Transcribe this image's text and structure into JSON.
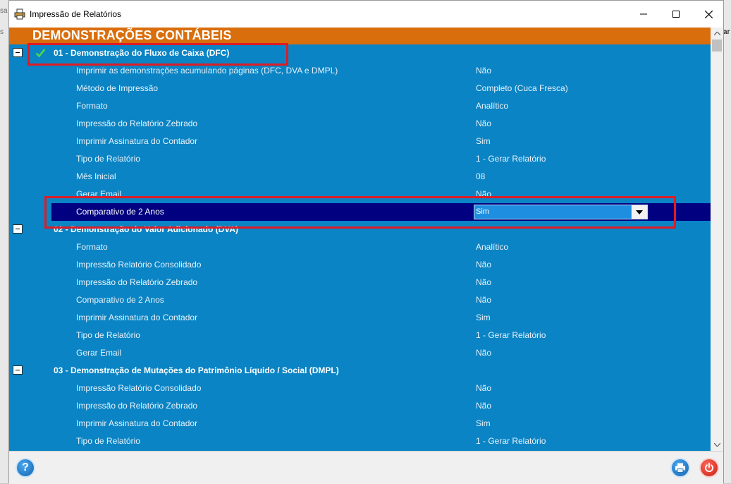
{
  "window": {
    "title": "Impressão de Relatórios",
    "minimize_icon": "minimize-icon",
    "maximize_icon": "maximize-icon",
    "close_icon": "close-icon"
  },
  "background": {
    "left_fragment_1": "sa",
    "left_fragment_2": "s",
    "right_fragment": "ar"
  },
  "header": {
    "title": "DEMONSTRAÇÕES CONTÁBEIS",
    "color": "#d96e0c"
  },
  "colors": {
    "panel": "#0a84c4",
    "selected_row": "#000080",
    "highlight": "#e01b24"
  },
  "sections": [
    {
      "title": "01 - Demonstração do Fluxo de Caixa (DFC)",
      "checked": true,
      "rows": [
        {
          "label": "Imprimir as demonstrações acumulando páginas (DFC, DVA e DMPL)",
          "value": "Não"
        },
        {
          "label": "Método de Impressão",
          "value": "Completo (Cuca Fresca)"
        },
        {
          "label": "Formato",
          "value": "Analítico"
        },
        {
          "label": "Impressão do Relatório Zebrado",
          "value": "Não"
        },
        {
          "label": "Imprimir Assinatura do Contador",
          "value": "Sim"
        },
        {
          "label": "Tipo de Relatório",
          "value": "1 - Gerar Relatório"
        },
        {
          "label": "Mês Inicial",
          "value": "08"
        },
        {
          "label": "Gerar Email",
          "value": "Não"
        },
        {
          "label": "Comparativo de 2 Anos",
          "value": "Sim",
          "selected": true
        }
      ]
    },
    {
      "title": "02 - Demonstração do Valor Adicionado (DVA)",
      "rows": [
        {
          "label": "Formato",
          "value": "Analítico"
        },
        {
          "label": "Impressão Relatório Consolidado",
          "value": "Não"
        },
        {
          "label": "Impressão do Relatório Zebrado",
          "value": "Não"
        },
        {
          "label": "Comparativo de 2 Anos",
          "value": "Não"
        },
        {
          "label": "Imprimir Assinatura do Contador",
          "value": "Sim"
        },
        {
          "label": "Tipo de Relatório",
          "value": "1 - Gerar Relatório"
        },
        {
          "label": "Gerar Email",
          "value": "Não"
        }
      ]
    },
    {
      "title": "03 - Demonstração de Mutações do Patrimônio Líquido / Social (DMPL)",
      "rows": [
        {
          "label": "Impressão Relatório Consolidado",
          "value": "Não"
        },
        {
          "label": "Impressão do Relatório Zebrado",
          "value": "Não"
        },
        {
          "label": "Imprimir Assinatura do Contador",
          "value": "Sim"
        },
        {
          "label": "Tipo de Relatório",
          "value": "1 - Gerar Relatório"
        }
      ]
    }
  ],
  "footer": {
    "help_icon": "help-icon",
    "help_label": "?",
    "print_icon": "printer-icon",
    "exit_icon": "power-icon"
  }
}
